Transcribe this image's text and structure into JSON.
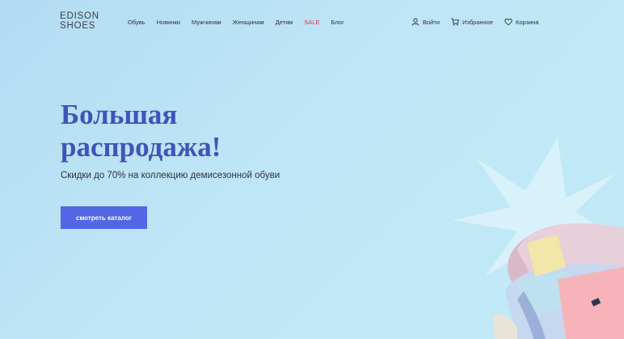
{
  "brand": {
    "line1": "EDISON",
    "line2": "SHOES"
  },
  "nav": {
    "items": [
      {
        "label": "Обувь"
      },
      {
        "label": "Новинки"
      },
      {
        "label": "Мужчинам"
      },
      {
        "label": "Женщинам"
      },
      {
        "label": "Детям"
      },
      {
        "label": "SALE"
      },
      {
        "label": "Блог"
      }
    ]
  },
  "user_nav": {
    "login": {
      "label": "Войти",
      "icon": "user-icon"
    },
    "favorites": {
      "label": "Избранное",
      "icon": "cart-icon"
    },
    "cart": {
      "label": "Корзина",
      "icon": "heart-icon"
    }
  },
  "hero": {
    "title_line1": "Большая",
    "title_line2": "распродажа!",
    "subtitle": "Скидки до 70% на коллекцию демисезонной обуви",
    "cta_label": "смотреть каталог"
  },
  "colors": {
    "accent": "#5366e6",
    "title": "#4253b8",
    "sale": "#e6304a"
  }
}
